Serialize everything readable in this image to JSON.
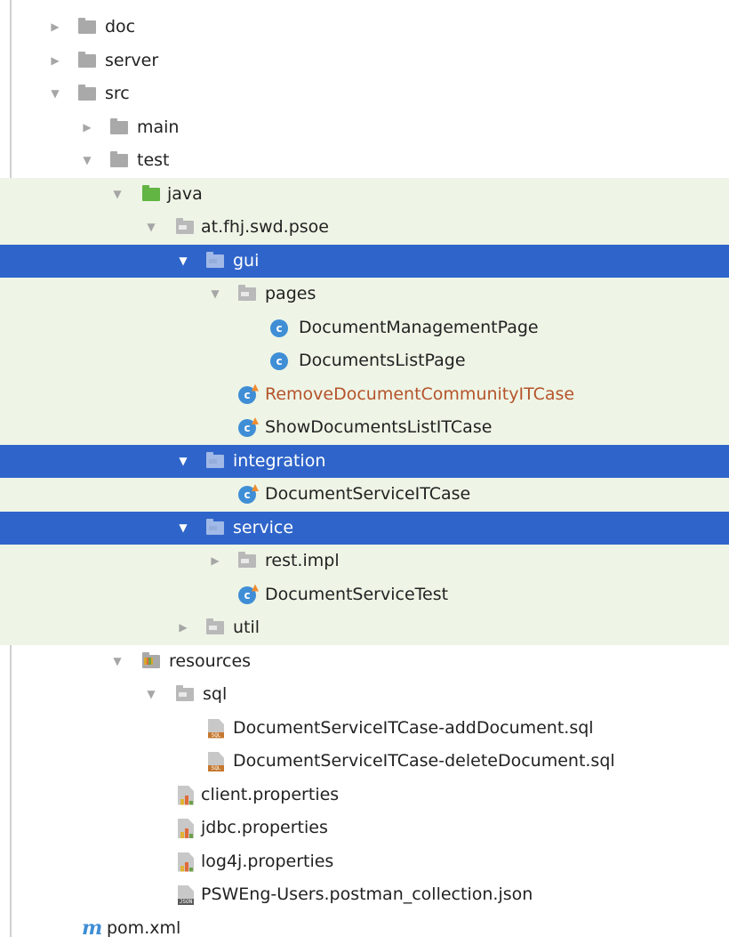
{
  "tree": {
    "doc": "doc",
    "server": "server",
    "src": "src",
    "main": "main",
    "test": "test",
    "java": "java",
    "package": "at.fhj.swd.psoe",
    "gui": "gui",
    "pages": "pages",
    "document_management_page": "DocumentManagementPage",
    "documents_list_page": "DocumentsListPage",
    "remove_document_community_itcase": "RemoveDocumentCommunityITCase",
    "show_documents_list_itcase": "ShowDocumentsListITCase",
    "integration": "integration",
    "document_service_itcase": "DocumentServiceITCase",
    "service": "service",
    "rest_impl": "rest.impl",
    "document_service_test": "DocumentServiceTest",
    "util": "util",
    "resources": "resources",
    "sql": "sql",
    "sql_add": "DocumentServiceITCase-addDocument.sql",
    "sql_delete": "DocumentServiceITCase-deleteDocument.sql",
    "client_properties": "client.properties",
    "jdbc_properties": "jdbc.properties",
    "log4j_properties": "log4j.properties",
    "postman_json": "PSWEng-Users.postman_collection.json",
    "pom": "pom.xml"
  },
  "icons": {
    "expanded": "▼",
    "collapsed": "▶",
    "class_letter": "c",
    "maven_letter": "m",
    "sql_tag": "SQL",
    "json_tag": "JSON"
  },
  "colors": {
    "selection": "#2f65ca",
    "test_background": "#eef5e6",
    "modified_text": "#b5532b",
    "class_icon": "#3f8ed6",
    "test_folder": "#62b543"
  }
}
